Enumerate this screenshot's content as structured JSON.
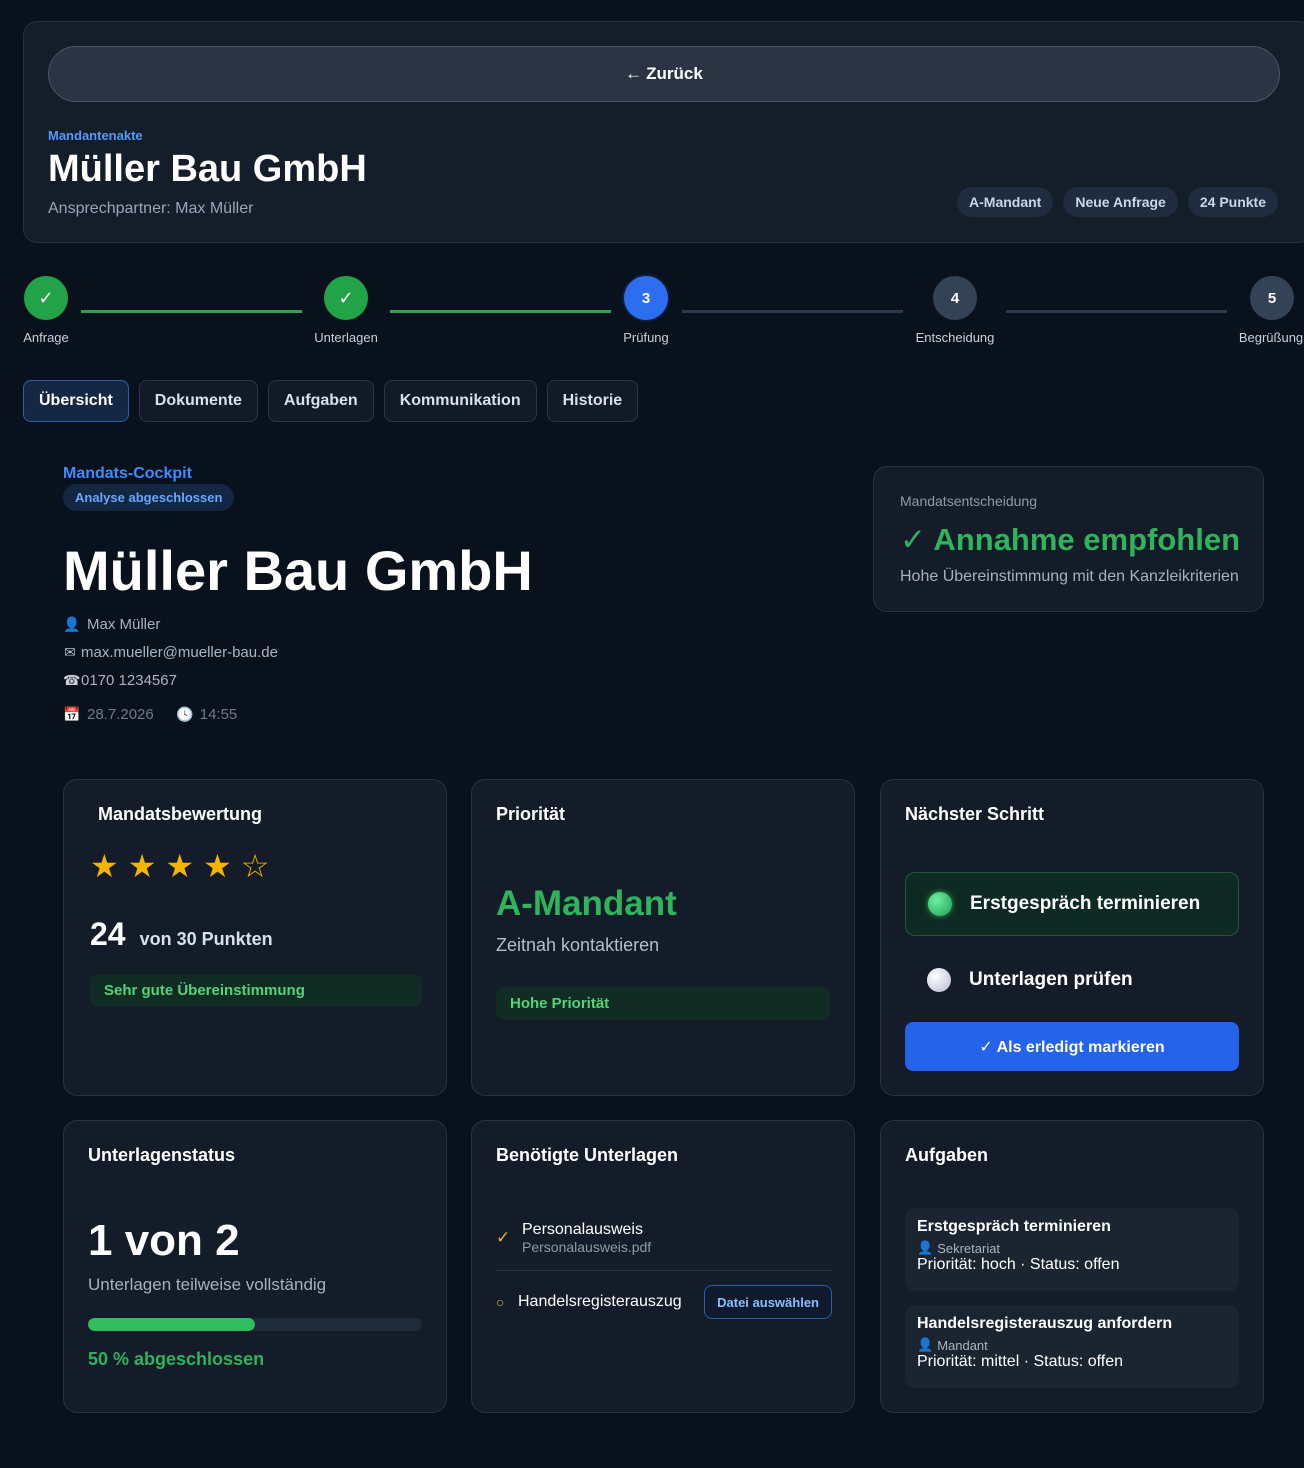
{
  "header": {
    "back_label": "Zurück",
    "back_icon": "←",
    "eyebrow": "Mandantenakte",
    "title": "Müller Bau GmbH",
    "contact": "Ansprechpartner: Max Müller",
    "badges": [
      "A-Mandant",
      "Neue Anfrage",
      "24 Punkte"
    ]
  },
  "stepper": {
    "steps": [
      {
        "label": "Anfrage",
        "marker": "✓",
        "state": "done"
      },
      {
        "label": "Unterlagen",
        "marker": "✓",
        "state": "done"
      },
      {
        "label": "Prüfung",
        "marker": "3",
        "state": "active"
      },
      {
        "label": "Entscheidung",
        "marker": "4",
        "state": "todo"
      },
      {
        "label": "Begrüßung",
        "marker": "5",
        "state": "todo"
      }
    ]
  },
  "tabs": [
    "Übersicht",
    "Dokumente",
    "Aufgaben",
    "Kommunikation",
    "Historie"
  ],
  "tabs_active": "Übersicht",
  "cockpit": {
    "eyebrow": "Mandats-Cockpit",
    "badge": "Analyse abgeschlossen",
    "title": "Müller Bau GmbH",
    "person": "Max Müller",
    "email": "max.mueller@mueller-bau.de",
    "phone": "0170 1234567",
    "date": "28.7.2026",
    "time": "14:55"
  },
  "decision": {
    "label": "Mandatsentscheidung",
    "value": "✓ Annahme empfohlen",
    "sub": "Hohe Übereinstimmung mit den Kanzleikriterien"
  },
  "rating": {
    "title": "Mandatsbewertung",
    "stars_filled": 4,
    "stars_total": 5,
    "score": "24",
    "score_unit": "von 30 Punkten",
    "badge": "Sehr gute Übereinstimmung"
  },
  "priority": {
    "title": "Priorität",
    "value": "A-Mandant",
    "sub": "Zeitnah kontaktieren",
    "badge": "Hohe Priorität"
  },
  "next_step": {
    "title": "Nächster Schritt",
    "active_item": "Erstgespräch terminieren",
    "item": "Unterlagen prüfen",
    "button": "✓ Als erledigt markieren"
  },
  "docs_status": {
    "title": "Unterlagenstatus",
    "value": "1 von 2",
    "sub": "Unterlagen teilweise vollständig",
    "progress_percent": 50,
    "progress_text": "50 % abgeschlossen"
  },
  "required_docs": {
    "title": "Benötigte Unterlagen",
    "items": [
      {
        "name": "Personalausweis",
        "file": "Personalausweis.pdf",
        "done": true
      },
      {
        "name": "Handelsregisterauszug",
        "file": "",
        "done": false,
        "button": "Datei auswählen"
      }
    ]
  },
  "tasks": {
    "title": "Aufgaben",
    "items": [
      {
        "title": "Erstgespräch terminieren",
        "owner": "Sekretariat",
        "meta": "Priorität: hoch · Status: offen"
      },
      {
        "title": "Handelsregisterauszug anfordern",
        "owner": "Mandant",
        "meta": "Priorität: mittel · Status: offen"
      }
    ]
  },
  "colors": {
    "background": "#08111c",
    "accent_blue": "#2563eb",
    "success_green": "#2fb35c",
    "star_gold": "#f5b400"
  }
}
